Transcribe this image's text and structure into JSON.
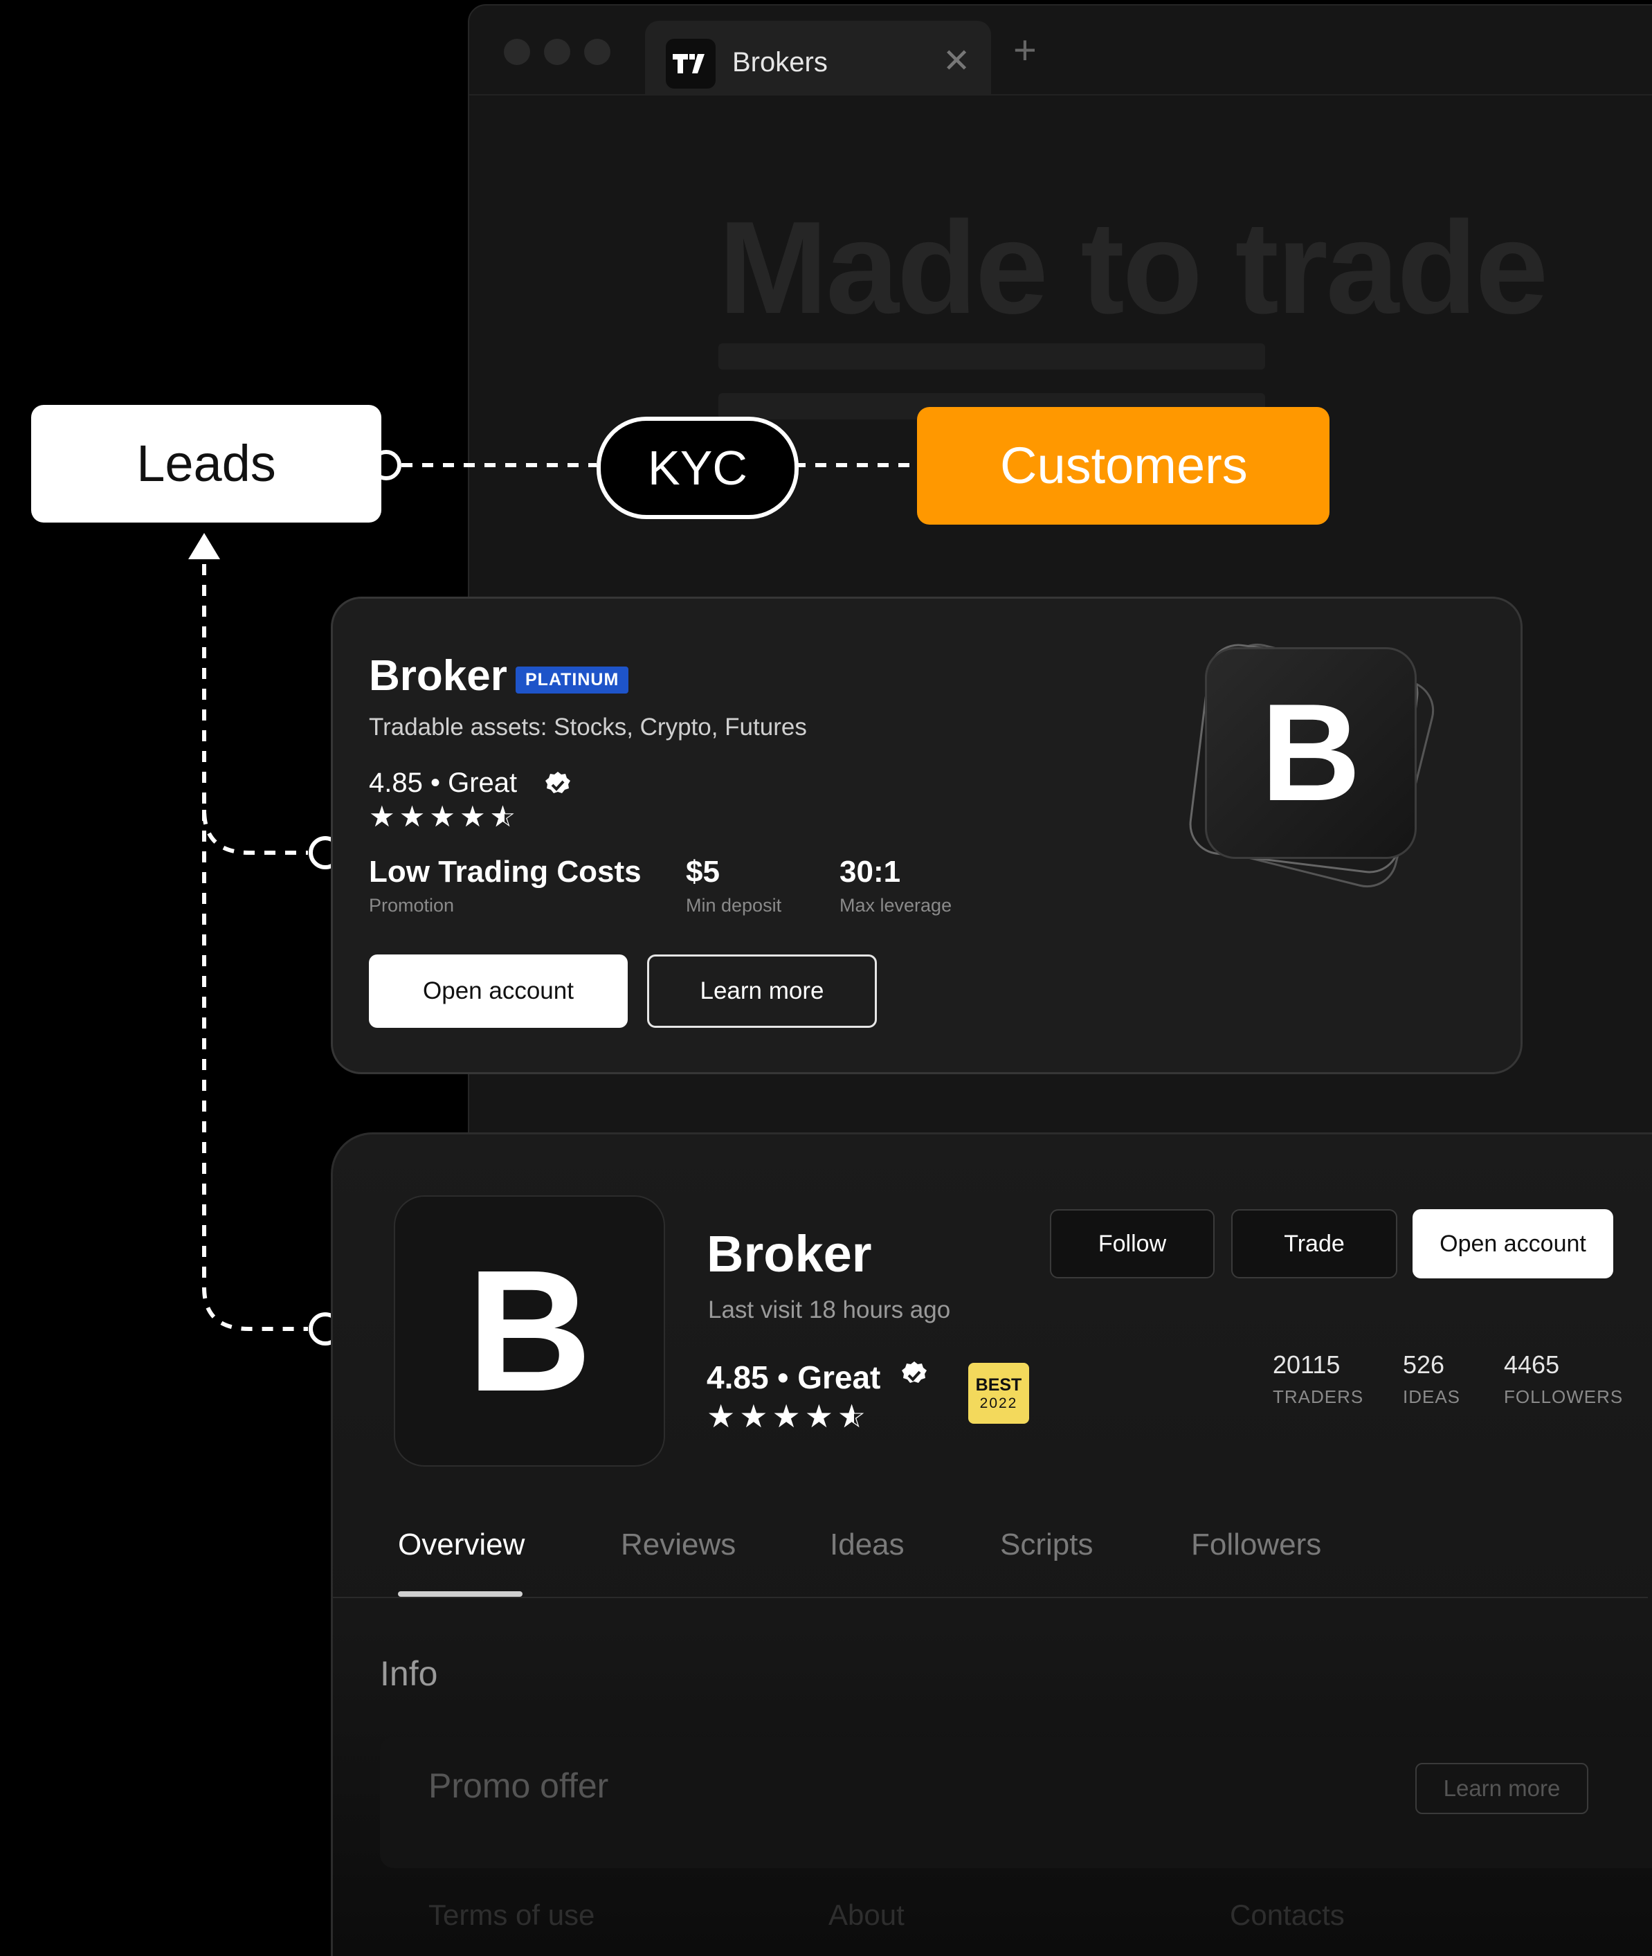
{
  "browser": {
    "tab_title": "Brokers",
    "tab_close": "✕",
    "new_tab": "+",
    "hero_title": "Made to trade"
  },
  "flow": {
    "leads": "Leads",
    "kyc": "KYC",
    "customers": "Customers",
    "customers_color": "#ff9800"
  },
  "card_compact": {
    "logo_letter": "B",
    "name": "Broker",
    "tier_badge": "PLATINUM",
    "tradable_assets": "Tradable assets: Stocks, Crypto, Futures",
    "rating": "4.85 • Great",
    "stars": 4.5,
    "promotion_value": "Low Trading Costs",
    "promotion_label": "Promotion",
    "min_deposit_value": "$5",
    "min_deposit_label": "Min deposit",
    "max_leverage_value": "30:1",
    "max_leverage_label": "Max leverage",
    "open_account": "Open account",
    "learn_more": "Learn more"
  },
  "card_profile": {
    "logo_letter": "B",
    "name": "Broker",
    "last_visit": "Last visit 18 hours ago",
    "rating": "4.85 • Great",
    "stars": 4.5,
    "award_line1": "BEST",
    "award_line2": "2022",
    "follow": "Follow",
    "trade": "Trade",
    "open_account": "Open account",
    "traders_value": "20115",
    "traders_label": "TRADERS",
    "ideas_value": "526",
    "ideas_label": "IDEAS",
    "followers_value": "4465",
    "followers_label": "FOLLOWERS",
    "tabs": [
      "Overview",
      "Reviews",
      "Ideas",
      "Scripts",
      "Followers"
    ],
    "active_tab": "Overview",
    "info_heading": "Info",
    "promo_offer": "Promo offer",
    "promo_learn_more": "Learn more",
    "footer_links": [
      "Terms of use",
      "About",
      "Contacts"
    ]
  }
}
